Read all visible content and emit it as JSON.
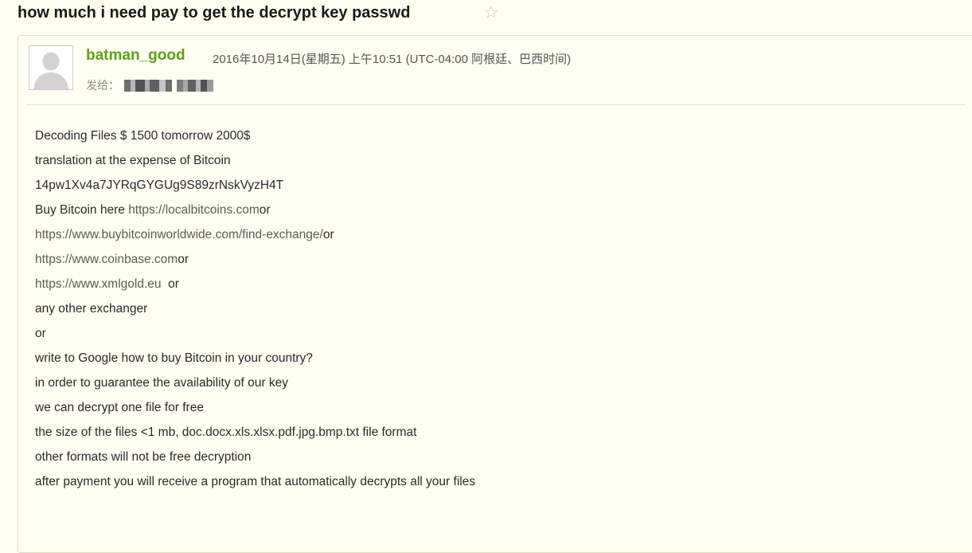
{
  "subject": {
    "title": "how much i need pay to get the decrypt key passwd",
    "star_icon": "☆"
  },
  "message": {
    "sender": "batman_good",
    "timestamp": "2016年10月14日(星期五) 上午10:51 (UTC-04:00 阿根廷、巴西时间)",
    "to_label": "发给：",
    "avatar_icon": "default-user-avatar-icon",
    "body": [
      {
        "text": "Decoding Files $ 1500 tomorrow 2000$"
      },
      {
        "text": "translation at the expense of Bitcoin"
      },
      {
        "text": "14pw1Xv4a7JYRqGYGUg9S89zrNskVyzH4T"
      },
      {
        "text": "Buy Bitcoin here ",
        "link": "https://localbitcoins.com",
        "after": "or"
      },
      {
        "text": "",
        "link": "https://www.buybitcoinworldwide.com/find-exchange/",
        "after": "or"
      },
      {
        "text": "",
        "link": "https://www.coinbase.com",
        "after": "or"
      },
      {
        "text": "",
        "link": "https://www.xmlgold.eu",
        "after": "  or"
      },
      {
        "text": "any other exchanger"
      },
      {
        "text": "or"
      },
      {
        "text": "write to Google how to buy Bitcoin in your country?"
      },
      {
        "text": "in order to guarantee the availability of our key"
      },
      {
        "text": "we can decrypt one file for free"
      },
      {
        "text": "the size of the files <1 mb, doc.docx.xls.xlsx.pdf.jpg.bmp.txt file format"
      },
      {
        "text": "other formats will not be free decryption"
      },
      {
        "text": "after payment you will receive a program that automatically decrypts all your files"
      }
    ]
  },
  "colors": {
    "background": "#fefef0",
    "sender": "#5f9e1a",
    "link": "#5a5a5a"
  }
}
